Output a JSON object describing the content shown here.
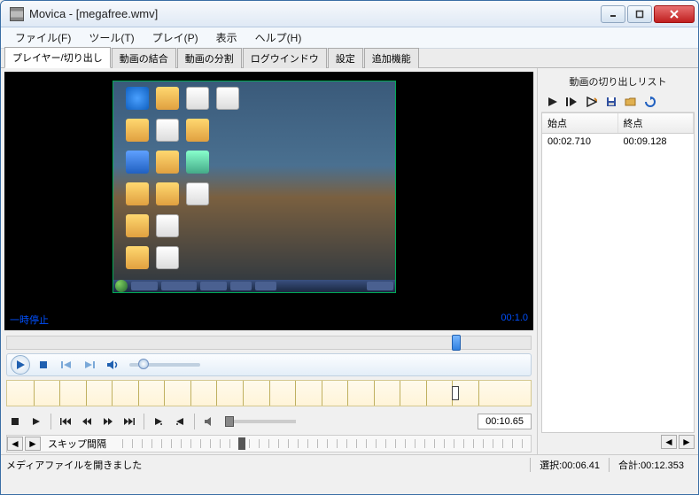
{
  "window": {
    "title": "Movica - [megafree.wmv]"
  },
  "menu": {
    "file": "ファイル(F)",
    "tools": "ツール(T)",
    "play": "プレイ(P)",
    "view": "表示",
    "help": "ヘルプ(H)"
  },
  "tabs": {
    "player": "プレイヤー/切り出し",
    "join": "動画の結合",
    "split": "動画の分割",
    "log": "ログウインドウ",
    "settings": "設定",
    "extra": "追加機能"
  },
  "overlay": {
    "pause": "一時停止",
    "time": "00:1.0"
  },
  "lower": {
    "time": "00:10.65"
  },
  "skip": {
    "label": "スキップ間隔"
  },
  "right": {
    "title": "動画の切り出しリスト",
    "col_start": "始点",
    "col_end": "終点",
    "row0_start": "00:02.710",
    "row0_end": "00:09.128"
  },
  "status": {
    "msg": "メディアファイルを開きました",
    "sel_label": "選択:",
    "sel_val": "00:06.41",
    "total_label": "合計:",
    "total_val": "00:12.353"
  },
  "icons": {
    "minimize": "minimize",
    "maximize": "maximize",
    "close": "close"
  }
}
